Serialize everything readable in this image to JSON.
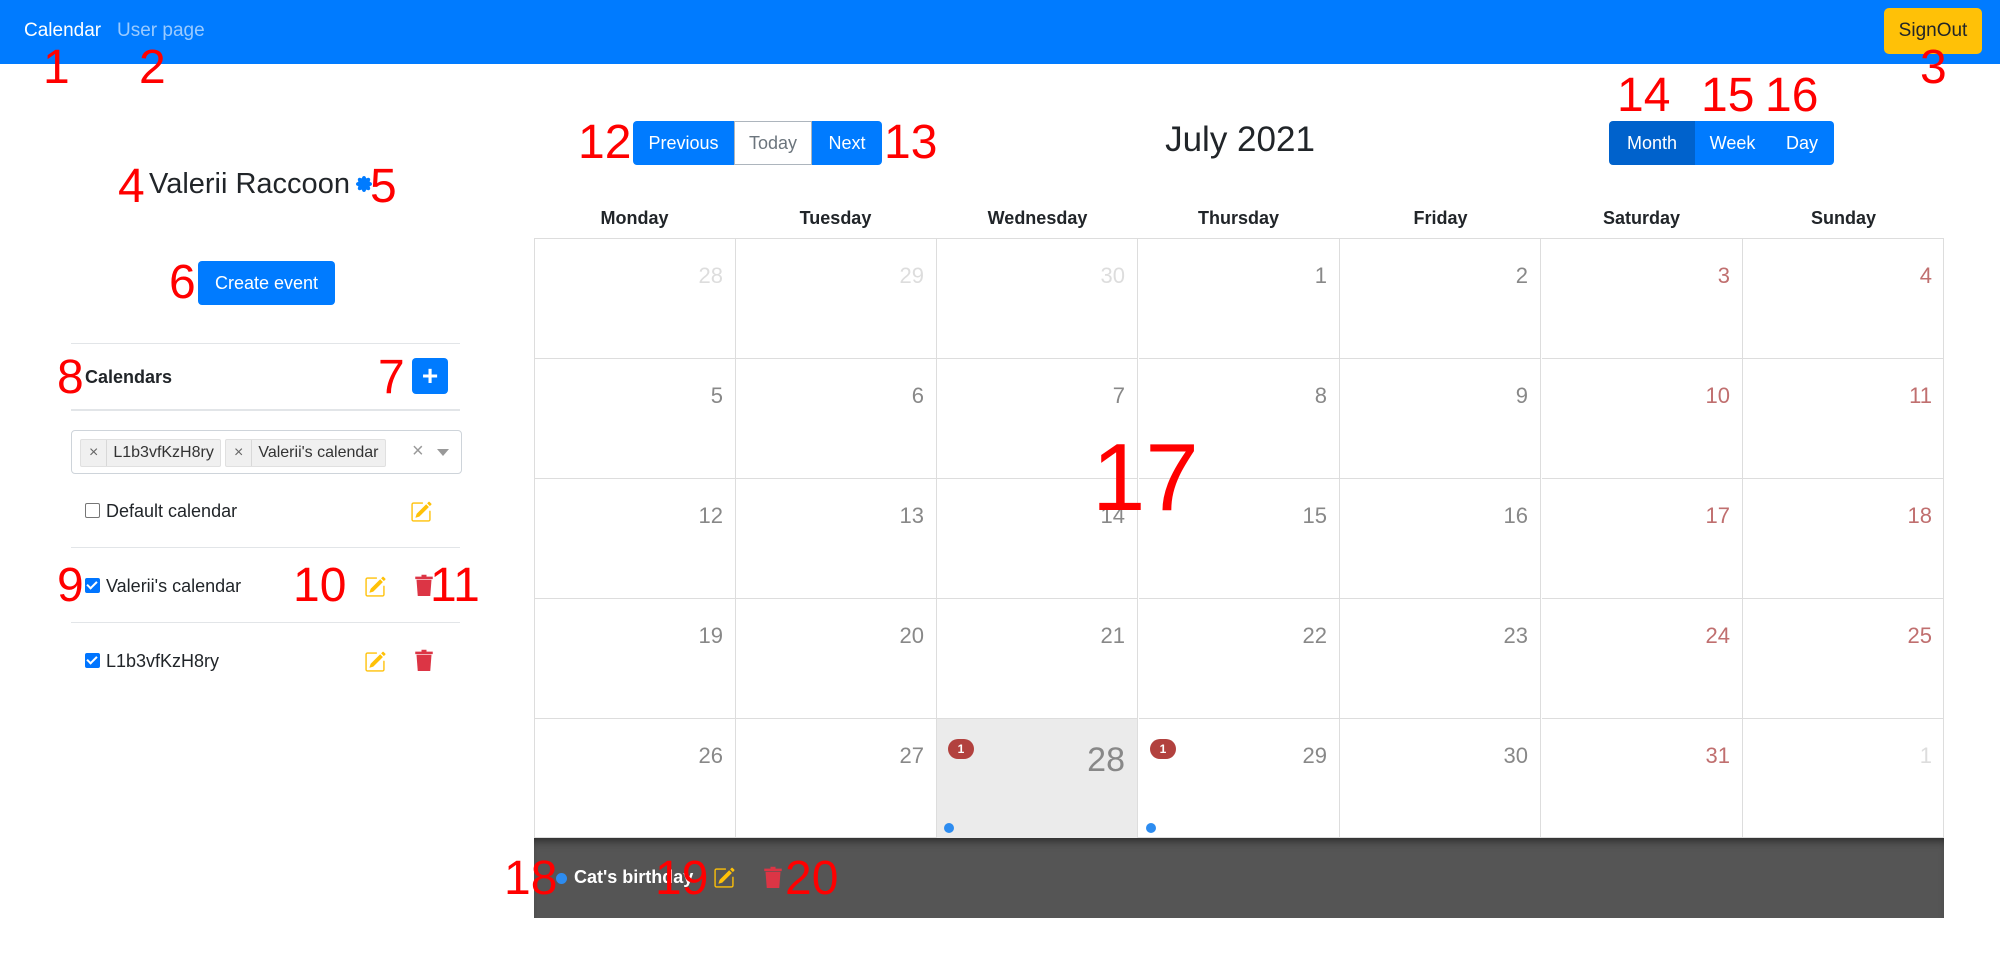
{
  "navbar": {
    "calendar_link": "Calendar",
    "user_page_link": "User page",
    "signout_label": "SignOut"
  },
  "sidebar": {
    "user_name": "Valerii Raccoon",
    "create_event_label": "Create event",
    "calendars_heading": "Calendars",
    "add_calendar_label": "+",
    "selected_chips": [
      "L1b3vfKzH8ry",
      "Valerii's calendar"
    ],
    "chip_remove": "×",
    "clear_all": "×",
    "calendars": [
      {
        "label": "Default calendar",
        "checked": false,
        "editable": true,
        "deletable": false
      },
      {
        "label": "Valerii's calendar",
        "checked": true,
        "editable": true,
        "deletable": true
      },
      {
        "label": "L1b3vfKzH8ry",
        "checked": true,
        "editable": true,
        "deletable": true
      }
    ]
  },
  "toolbar": {
    "previous_label": "Previous",
    "today_label": "Today",
    "next_label": "Next",
    "month_title": "July 2021",
    "views": [
      "Month",
      "Week",
      "Day"
    ],
    "active_view": "Month"
  },
  "calendar": {
    "weekdays": [
      "Monday",
      "Tuesday",
      "Wednesday",
      "Thursday",
      "Friday",
      "Saturday",
      "Sunday"
    ],
    "weeks": [
      [
        {
          "d": "28",
          "other": true
        },
        {
          "d": "29",
          "other": true
        },
        {
          "d": "30",
          "other": true
        },
        {
          "d": "1"
        },
        {
          "d": "2"
        },
        {
          "d": "3",
          "weekend": true
        },
        {
          "d": "4",
          "weekend": true
        }
      ],
      [
        {
          "d": "5"
        },
        {
          "d": "6"
        },
        {
          "d": "7"
        },
        {
          "d": "8"
        },
        {
          "d": "9"
        },
        {
          "d": "10",
          "weekend": true
        },
        {
          "d": "11",
          "weekend": true
        }
      ],
      [
        {
          "d": "12"
        },
        {
          "d": "13"
        },
        {
          "d": "14"
        },
        {
          "d": "15"
        },
        {
          "d": "16"
        },
        {
          "d": "17",
          "weekend": true
        },
        {
          "d": "18",
          "weekend": true
        }
      ],
      [
        {
          "d": "19"
        },
        {
          "d": "20"
        },
        {
          "d": "21"
        },
        {
          "d": "22"
        },
        {
          "d": "23"
        },
        {
          "d": "24",
          "weekend": true
        },
        {
          "d": "25",
          "weekend": true
        }
      ],
      [
        {
          "d": "26"
        },
        {
          "d": "27"
        },
        {
          "d": "28",
          "selected": true,
          "badge": "1",
          "dot": true
        },
        {
          "d": "29",
          "badge": "1",
          "dot": true
        },
        {
          "d": "30"
        },
        {
          "d": "31",
          "weekend": true
        },
        {
          "d": "1",
          "other": true
        }
      ]
    ]
  },
  "event_panel": {
    "event_title": "Cat's birthday"
  },
  "annotations": [
    "1",
    "2",
    "3",
    "4",
    "5",
    "6",
    "7",
    "8",
    "9",
    "10",
    "11",
    "12",
    "13",
    "14",
    "15",
    "16",
    "17",
    "18",
    "19",
    "20"
  ],
  "colors": {
    "primary": "#007bff",
    "warning": "#ffc107",
    "danger": "#dc3545",
    "active_view": "#0062cc",
    "event_dot": "#2d8cf0"
  }
}
